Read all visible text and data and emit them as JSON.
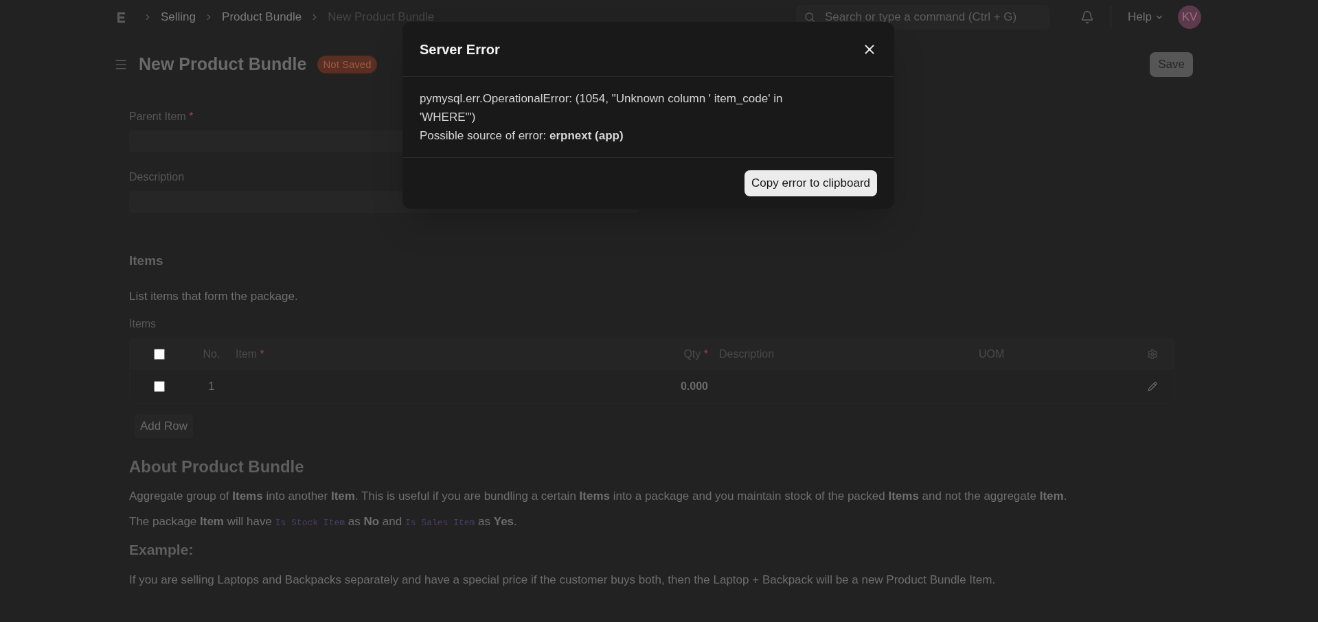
{
  "breadcrumbs": [
    {
      "label": "Selling",
      "current": false
    },
    {
      "label": "Product Bundle",
      "current": false
    },
    {
      "label": "New Product Bundle",
      "current": true
    }
  ],
  "search": {
    "placeholder": "Search or type a command (Ctrl + G)"
  },
  "help": "Help",
  "required_mark": "*",
  "avatar": "KV",
  "page": {
    "title": "New Product Bundle",
    "badge": "Not Saved",
    "save": "Save"
  },
  "fields": [
    {
      "label": "Parent Item",
      "required": true
    },
    {
      "label": "Description",
      "required": false
    }
  ],
  "items_section": {
    "title": "Items",
    "description": "List items that form the package.",
    "table_label": "Items",
    "all_selected": false,
    "columns": [
      {
        "label": "No.",
        "required": false
      },
      {
        "label": "Item",
        "required": true
      },
      {
        "label": "Qty",
        "required": true
      },
      {
        "label": "Description",
        "required": false
      },
      {
        "label": "UOM",
        "required": false
      }
    ],
    "rows": [
      {
        "no": "1",
        "item": "",
        "qty": "0.000",
        "description": "",
        "uom": "",
        "checked": false
      }
    ],
    "add_row": "Add Row"
  },
  "about": {
    "title": "About Product Bundle",
    "paragraphs": [
      [
        {
          "kind": "text",
          "text": "Aggregate group of **Items** into another **Item**. This is useful if you are bundling a certain **Items** into a package and you maintain stock of the packed **Items** and not the aggregate **Item**."
        }
      ],
      [
        {
          "kind": "text",
          "text": "The package **Item** will have "
        },
        {
          "kind": "code",
          "text": "Is Stock Item"
        },
        {
          "kind": "text",
          "text": " as **No** and "
        },
        {
          "kind": "code",
          "text": "Is Sales Item"
        },
        {
          "kind": "text",
          "text": " as **Yes**."
        }
      ]
    ],
    "example_title": "Example:",
    "example": "If you are selling Laptops and Backpacks separately and have a special price if the customer buys both, then the Laptop + Backpack will be a new Product Bundle Item."
  },
  "dialog": {
    "title": "Server Error",
    "message": "pymysql.err.OperationalError: (1054, \"Unknown column ' item_code' in 'WHERE'\")",
    "source": "Possible source of error: **erpnext (app)**",
    "button": "Copy error to clipboard"
  }
}
